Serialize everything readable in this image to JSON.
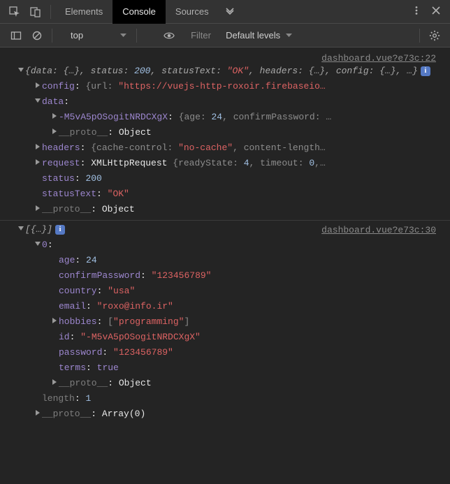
{
  "toolbar": {
    "tabs": {
      "elements": "Elements",
      "console": "Console",
      "sources": "Sources"
    }
  },
  "subtoolbar": {
    "context": "top",
    "filter_placeholder": "Filter",
    "levels": "Default levels"
  },
  "log1": {
    "source": "dashboard.vue?e73c:22",
    "summary": {
      "data_label": "data:",
      "data_val": "{…}",
      "status_label": "status:",
      "status_val": "200",
      "statusText_label": "statusText:",
      "statusText_val": "\"OK\"",
      "headers_label": "headers:",
      "headers_val": "{…}",
      "config_label": "config:",
      "config_val": "{…}",
      "trailing": "…"
    },
    "config": {
      "key": "config",
      "url_key": "url",
      "url_val": "\"https://vuejs-http-roxoir.firebaseio…"
    },
    "data": {
      "key": "data",
      "entry_key": "-M5vA5pOSogitNRDCXgX",
      "age_key": "age",
      "age_val": "24",
      "confirm_key": "confirmPassword",
      "confirm_preview": "…",
      "proto_key": "__proto__",
      "proto_val": "Object"
    },
    "headers": {
      "key": "headers",
      "cache_key": "cache-control",
      "cache_val": "\"no-cache\"",
      "cl_key": "content-length…"
    },
    "request": {
      "key": "request",
      "ctor": "XMLHttpRequest",
      "ready_key": "readyState",
      "ready_val": "4",
      "timeout_key": "timeout",
      "timeout_val": "0",
      "trailing": ",…"
    },
    "status": {
      "key": "status",
      "val": "200"
    },
    "statusText": {
      "key": "statusText",
      "val": "\"OK\""
    },
    "proto": {
      "key": "__proto__",
      "val": "Object"
    }
  },
  "log2": {
    "source": "dashboard.vue?e73c:30",
    "summary": "[{…}]",
    "idx0": {
      "key": "0",
      "age_key": "age",
      "age_val": "24",
      "confirm_key": "confirmPassword",
      "confirm_val": "\"123456789\"",
      "country_key": "country",
      "country_val": "\"usa\"",
      "email_key": "email",
      "email_val": "\"roxo@info.ir\"",
      "hobbies_key": "hobbies",
      "hobbies_val": "\"programming\"",
      "id_key": "id",
      "id_val": "\"-M5vA5pOSogitNRDCXgX\"",
      "password_key": "password",
      "password_val": "\"123456789\"",
      "terms_key": "terms",
      "terms_val": "true",
      "proto_key": "__proto__",
      "proto_val": "Object"
    },
    "length": {
      "key": "length",
      "val": "1"
    },
    "proto": {
      "key": "__proto__",
      "val": "Array(0)"
    }
  }
}
